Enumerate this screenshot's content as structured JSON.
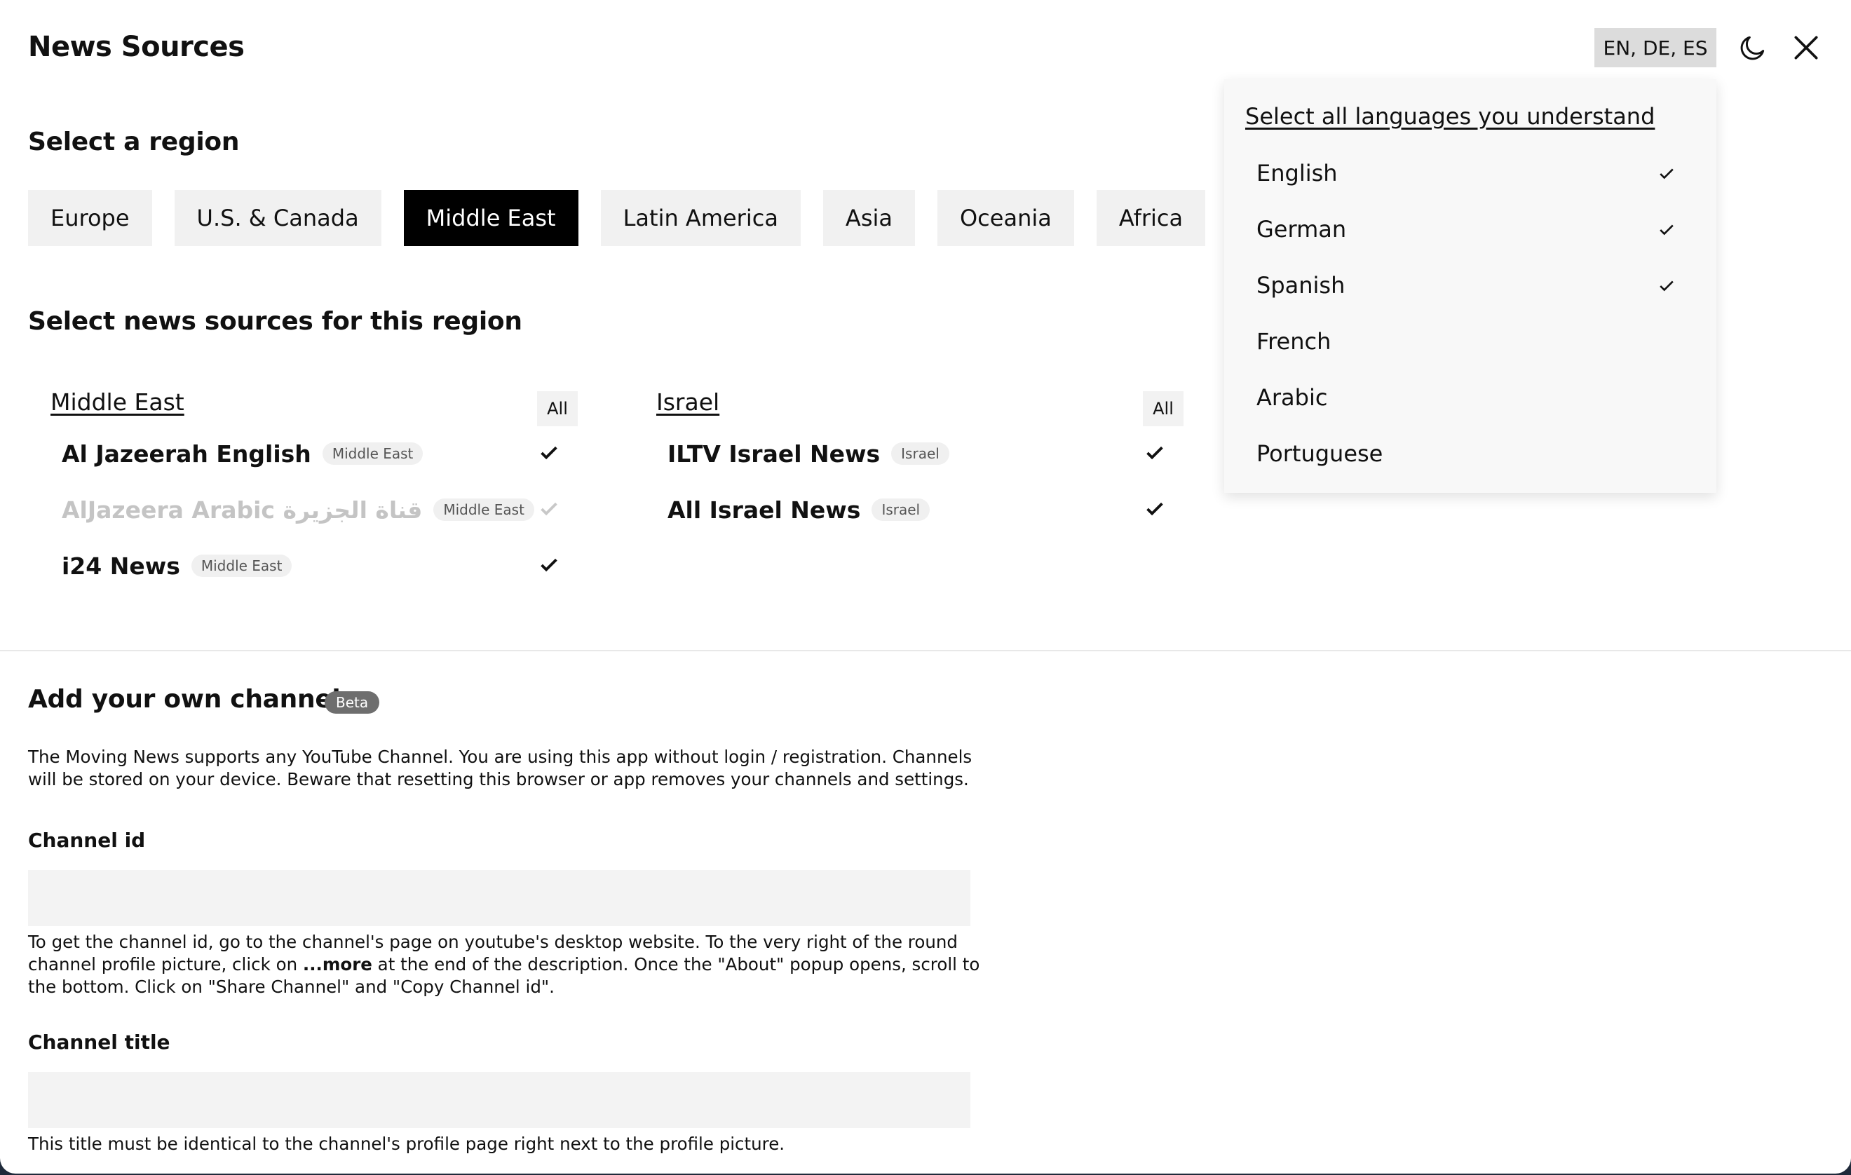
{
  "header": {
    "title": "News Sources",
    "language_button": "EN, DE, ES",
    "theme_icon": "moon-icon",
    "close_icon": "close-icon"
  },
  "regions": {
    "heading": "Select a region",
    "items": [
      {
        "label": "Europe",
        "active": false
      },
      {
        "label": "U.S. & Canada",
        "active": false
      },
      {
        "label": "Middle East",
        "active": true
      },
      {
        "label": "Latin America",
        "active": false
      },
      {
        "label": "Asia",
        "active": false
      },
      {
        "label": "Oceania",
        "active": false
      },
      {
        "label": "Africa",
        "active": false
      }
    ]
  },
  "sources": {
    "heading": "Select news sources for this region",
    "groups": [
      {
        "title": "Middle East",
        "all_label": "All",
        "items": [
          {
            "name": "Al Jazeerah English",
            "tag": "Middle East",
            "checked": true,
            "disabled": false
          },
          {
            "name": "AlJazeera Arabic قناة الجزيرة",
            "tag": "Middle East",
            "checked": true,
            "disabled": true
          },
          {
            "name": "i24 News",
            "tag": "Middle East",
            "checked": true,
            "disabled": false
          }
        ]
      },
      {
        "title": "Israel",
        "all_label": "All",
        "items": [
          {
            "name": "ILTV Israel News",
            "tag": "Israel",
            "checked": true,
            "disabled": false
          },
          {
            "name": "All Israel News",
            "tag": "Israel",
            "checked": true,
            "disabled": false
          }
        ]
      }
    ]
  },
  "own_channels": {
    "heading": "Add your own channels",
    "badge": "Beta",
    "description": "The Moving News supports any YouTube Channel. You are using this app without login / registration. Channels will be stored on your device. Beware that resetting this browser or app removes your channels and settings.",
    "channel_id": {
      "label": "Channel id",
      "value": "",
      "placeholder": "",
      "help_before": "To get the channel id, go to the channel's page on youtube's desktop website. To the very right of the round channel profile picture, click on ",
      "help_bold": "...more",
      "help_after": " at the end of the description. Once the \"About\" popup opens, scroll to the bottom. Click on \"Share Channel\" and \"Copy Channel id\"."
    },
    "channel_title": {
      "label": "Channel title",
      "value": "",
      "placeholder": "",
      "help": "This title must be identical to the channel's profile page right next to the profile picture."
    }
  },
  "language_dropdown": {
    "title": "Select all languages you understand",
    "items": [
      {
        "label": "English",
        "checked": true
      },
      {
        "label": "German",
        "checked": true
      },
      {
        "label": "Spanish",
        "checked": true
      },
      {
        "label": "French",
        "checked": false
      },
      {
        "label": "Arabic",
        "checked": false
      },
      {
        "label": "Portuguese",
        "checked": false
      }
    ]
  }
}
